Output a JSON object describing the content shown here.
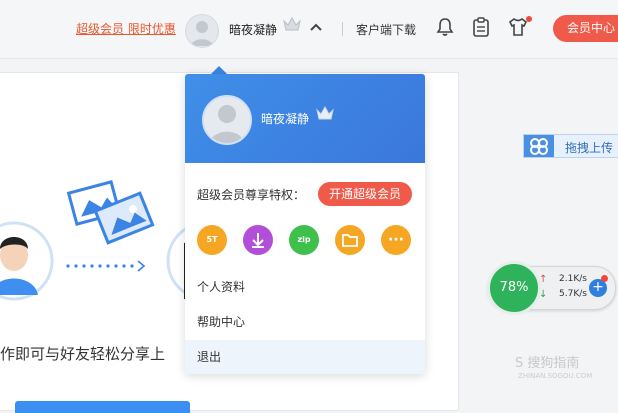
{
  "header": {
    "promo_link": "超级会员 限时优惠",
    "username": "暗夜凝静",
    "client_download": "客户端下载",
    "vip_center_button": "会员中心"
  },
  "dropdown": {
    "username": "暗夜凝静",
    "privileges_label": "超级会员尊享特权：",
    "open_vip_button": "开通超级会员",
    "perks": [
      {
        "label": "5T",
        "icon": "storage-5t-icon",
        "color": "#f5a623"
      },
      {
        "label": "",
        "icon": "download-speed-icon",
        "color": "#b14fd8"
      },
      {
        "label": "zip",
        "icon": "zip-icon",
        "color": "#3fc04c"
      },
      {
        "label": "",
        "icon": "folder-icon",
        "color": "#f5a623"
      },
      {
        "label": "···",
        "icon": "more-icon",
        "color": "#f5a623"
      }
    ],
    "menu": [
      {
        "label": "个人资料"
      },
      {
        "label": "帮助中心"
      },
      {
        "label": "退出"
      }
    ]
  },
  "main": {
    "share_text": "作即可与好友轻松分享上"
  },
  "upload": {
    "label": "拖拽上传"
  },
  "speed": {
    "percent": "78%",
    "up": "2.1K/s",
    "down": "5.7K/s"
  },
  "watermark": {
    "text": "S 搜狗指南",
    "sub": "ZHINAN.SOGOU.COM"
  },
  "colors": {
    "accent_red": "#f05a4a",
    "brand_blue": "#3b84e4",
    "speed_green": "#2fb25c"
  }
}
